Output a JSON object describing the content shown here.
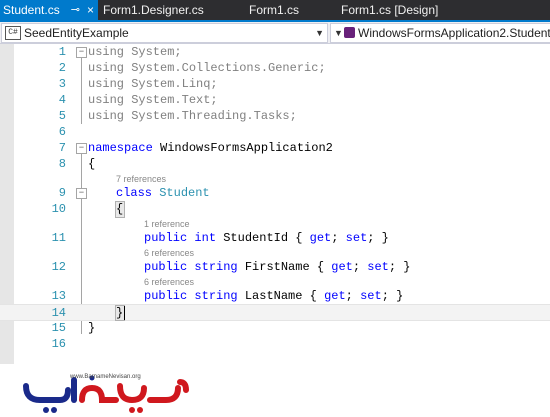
{
  "tabs": [
    {
      "label": "Student.cs",
      "active": true,
      "pin": "⊸",
      "close": "×"
    },
    {
      "label": "Form1.Designer.cs",
      "active": false
    },
    {
      "label": "Form1.cs",
      "active": false
    },
    {
      "label": "Form1.cs [Design]",
      "active": false
    }
  ],
  "navbar": {
    "left_value": "SeedEntityExample",
    "left_icon_text": "C#",
    "right_value": "WindowsFormsApplication2.Student"
  },
  "editor": {
    "line_numbers": [
      "1",
      "2",
      "3",
      "4",
      "5",
      "6",
      "7",
      "8",
      "9",
      "10",
      "11",
      "12",
      "13",
      "14",
      "15",
      "16"
    ],
    "usings": [
      "using System;",
      "using System.Collections.Generic;",
      "using System.Linq;",
      "using System.Text;",
      "using System.Threading.Tasks;"
    ],
    "namespace_keyword": "namespace",
    "namespace_name": " WindowsFormsApplication2",
    "open_brace": "{",
    "close_brace": "}",
    "class_refs": "7 references",
    "class_keyword": "class",
    "class_name": "Student",
    "properties": [
      {
        "refs": "1 reference",
        "modifier": "public",
        "type": "int",
        "rest": " StudentId { ",
        "get": "get",
        "set": "set",
        "end": "; }"
      },
      {
        "refs": "6 references",
        "modifier": "public",
        "type": "string",
        "rest": " FirstName { ",
        "get": "get",
        "set": "set",
        "end": "; }"
      },
      {
        "refs": "6 references",
        "modifier": "public",
        "type": "string",
        "rest": " LastName { ",
        "get": "get",
        "set": "set",
        "end": "; }"
      }
    ],
    "fold_minus": "−",
    "colors": {
      "keyword": "#0000ff",
      "type": "#2b91af",
      "line_number": "#2b91af",
      "dimmed": "#808080"
    }
  },
  "watermark": {
    "url_text": "www.BarnameNevisan.org",
    "logo_colors": [
      "#1a2a8a",
      "#d0181e"
    ]
  }
}
